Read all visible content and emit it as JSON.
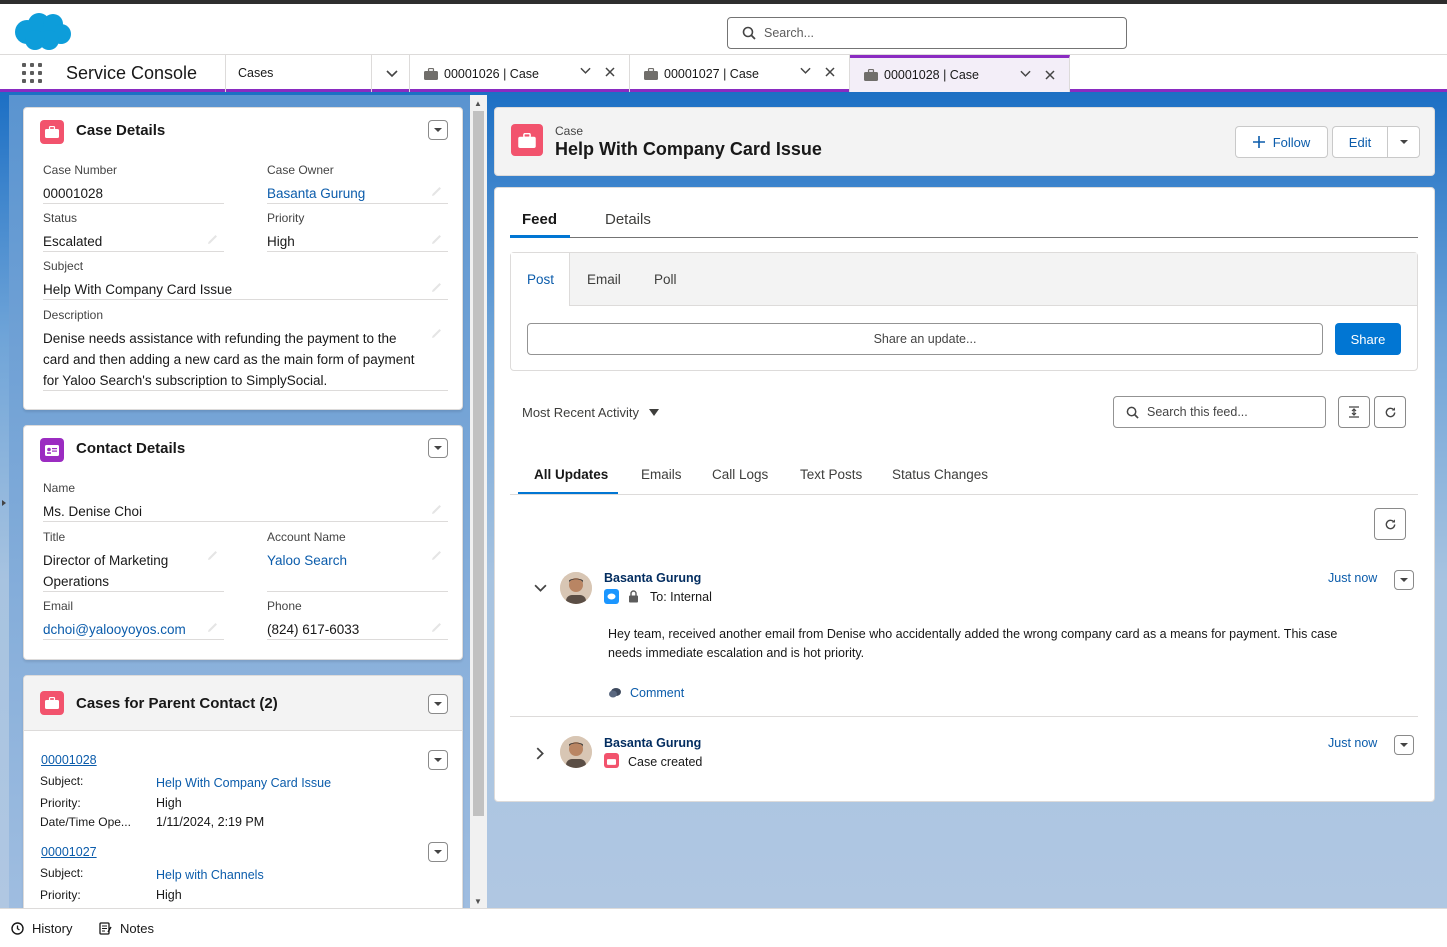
{
  "header": {
    "search_placeholder": "Search...",
    "app_name": "Service Console",
    "nav_selector": "Cases",
    "tabs": [
      {
        "label": "00001026 | Case"
      },
      {
        "label": "00001027 | Case"
      },
      {
        "label": "00001028 | Case"
      }
    ],
    "accent_color": "#8a2bc1"
  },
  "case_details": {
    "title": "Case Details",
    "case_number_label": "Case Number",
    "case_number": "00001028",
    "case_owner_label": "Case Owner",
    "case_owner": "Basanta Gurung",
    "status_label": "Status",
    "status": "Escalated",
    "priority_label": "Priority",
    "priority": "High",
    "subject_label": "Subject",
    "subject": "Help With Company Card Issue",
    "description_label": "Description",
    "description": "Denise needs assistance with refunding the payment to the card and then adding a new card as the main form of payment for Yaloo Search's subscription to SimplySocial."
  },
  "contact_details": {
    "title": "Contact Details",
    "name_label": "Name",
    "name": "Ms. Denise Choi",
    "title_label": "Title",
    "title_value": "Director of Marketing Operations",
    "account_label": "Account Name",
    "account": "Yaloo Search",
    "email_label": "Email",
    "email": "dchoi@yalooyoyos.com",
    "phone_label": "Phone",
    "phone": "(824) 617-6033"
  },
  "parent_cases": {
    "title": "Cases for Parent Contact (2)",
    "subject_label": "Subject:",
    "priority_label": "Priority:",
    "opened_label": "Date/Time Ope...",
    "items": [
      {
        "number": "00001028",
        "subject": "Help With Company Card Issue",
        "priority": "High",
        "opened": "1/11/2024, 2:19 PM"
      },
      {
        "number": "00001027",
        "subject": "Help with Channels",
        "priority": "High"
      }
    ]
  },
  "record": {
    "object_label": "Case",
    "title": "Help With Company Card Issue",
    "follow_label": "Follow",
    "edit_label": "Edit"
  },
  "main_tabs": {
    "feed": "Feed",
    "details": "Details"
  },
  "publisher": {
    "tabs": [
      "Post",
      "Email",
      "Poll"
    ],
    "placeholder": "Share an update...",
    "share_label": "Share"
  },
  "feed_controls": {
    "sort": "Most Recent Activity",
    "search_placeholder": "Search this feed..."
  },
  "feed_filters": [
    "All Updates",
    "Emails",
    "Call Logs",
    "Text Posts",
    "Status Changes"
  ],
  "feed_items": [
    {
      "author": "Basanta Gurung",
      "meta": "To: Internal",
      "time": "Just now",
      "body": "Hey team, received another email from Denise who accidentally added the wrong company card as a means for payment. This case needs immediate escalation and is hot priority.",
      "comment_label": "Comment"
    },
    {
      "author": "Basanta Gurung",
      "meta": "Case created",
      "time": "Just now"
    }
  ],
  "footer": {
    "history": "History",
    "notes": "Notes"
  }
}
